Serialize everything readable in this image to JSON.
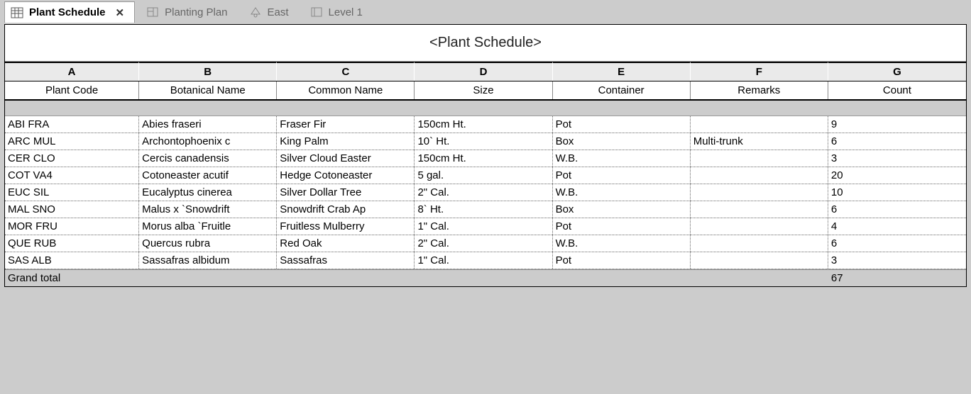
{
  "tabs": [
    {
      "label": "Plant Schedule",
      "active": true,
      "icon": "schedule"
    },
    {
      "label": "Planting Plan",
      "active": false,
      "icon": "plan"
    },
    {
      "label": "East",
      "active": false,
      "icon": "elev"
    },
    {
      "label": "Level 1",
      "active": false,
      "icon": "level"
    }
  ],
  "schedule": {
    "title": "<Plant Schedule>",
    "column_letters": [
      "A",
      "B",
      "C",
      "D",
      "E",
      "F",
      "G"
    ],
    "column_headers": [
      "Plant Code",
      "Botanical Name",
      "Common Name",
      "Size",
      "Container",
      "Remarks",
      "Count"
    ],
    "rows": [
      {
        "code": "ABI FRA",
        "botanical": "Abies fraseri",
        "common": "Fraser Fir",
        "size": "150cm Ht.",
        "container": "Pot",
        "remarks": "",
        "count": "9"
      },
      {
        "code": "ARC MUL",
        "botanical": "Archontophoenix c",
        "common": "King Palm",
        "size": "10` Ht.",
        "container": "Box",
        "remarks": "Multi-trunk",
        "count": "6"
      },
      {
        "code": "CER CLO",
        "botanical": "Cercis canadensis",
        "common": "Silver Cloud Easter",
        "size": "150cm Ht.",
        "container": "W.B.",
        "remarks": "",
        "count": "3"
      },
      {
        "code": "COT VA4",
        "botanical": "Cotoneaster acutif",
        "common": "Hedge Cotoneaster",
        "size": "5 gal.",
        "container": "Pot",
        "remarks": "",
        "count": "20"
      },
      {
        "code": "EUC SIL",
        "botanical": "Eucalyptus cinerea",
        "common": "Silver Dollar Tree",
        "size": "2\" Cal.",
        "container": "W.B.",
        "remarks": "",
        "count": "10"
      },
      {
        "code": "MAL SNO",
        "botanical": "Malus x `Snowdrift",
        "common": "Snowdrift Crab Ap",
        "size": "8` Ht.",
        "container": "Box",
        "remarks": "",
        "count": "6"
      },
      {
        "code": "MOR FRU",
        "botanical": "Morus alba `Fruitle",
        "common": "Fruitless Mulberry",
        "size": "1\" Cal.",
        "container": "Pot",
        "remarks": "",
        "count": "4"
      },
      {
        "code": "QUE RUB",
        "botanical": "Quercus rubra",
        "common": "Red Oak",
        "size": "2\" Cal.",
        "container": "W.B.",
        "remarks": "",
        "count": "6"
      },
      {
        "code": "SAS ALB",
        "botanical": "Sassafras albidum",
        "common": "Sassafras",
        "size": "1\" Cal.",
        "container": "Pot",
        "remarks": "",
        "count": "3"
      }
    ],
    "total_label": "Grand total",
    "total_count": "67"
  }
}
